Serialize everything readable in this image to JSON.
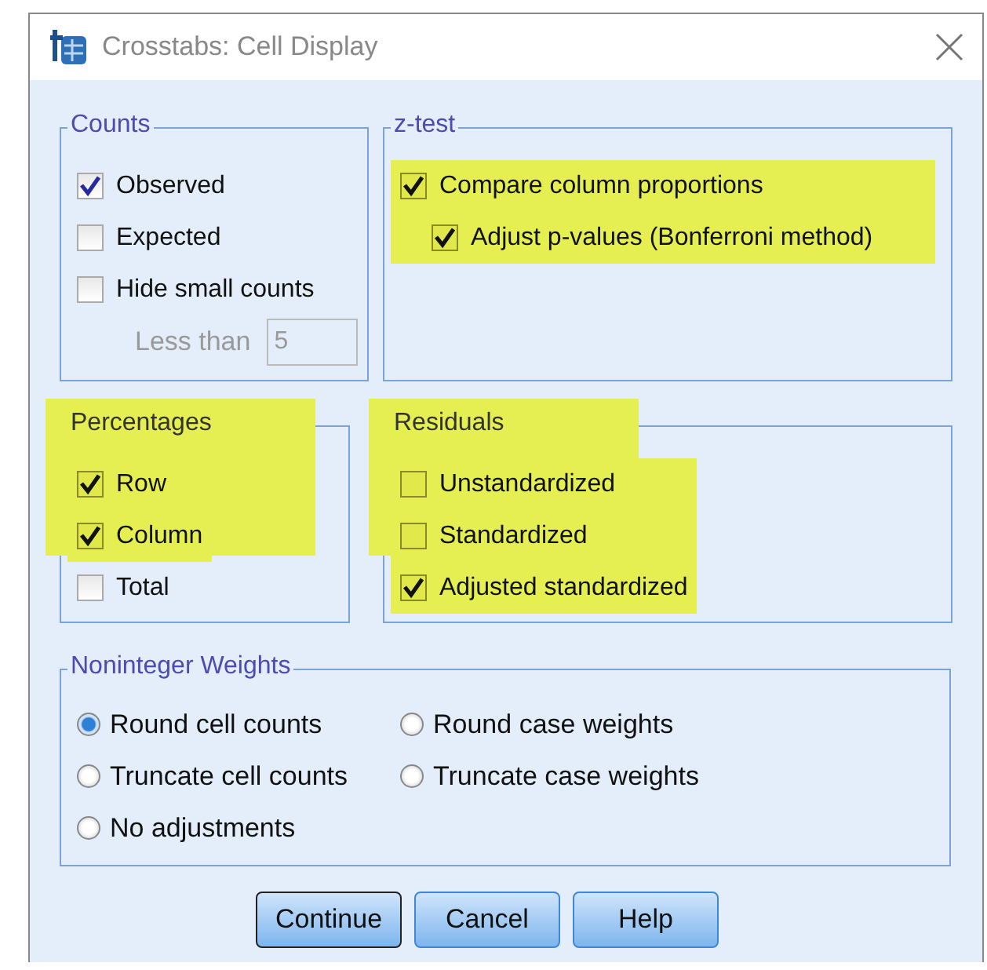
{
  "window": {
    "title": "Crosstabs: Cell Display"
  },
  "groups": [
    {
      "title": "Counts",
      "legend_highlighted": false,
      "items": [
        {
          "label": "Observed",
          "checked": true,
          "highlighted": false
        },
        {
          "label": "Expected",
          "checked": false,
          "highlighted": false
        },
        {
          "label": "Hide small counts",
          "checked": false,
          "highlighted": false
        }
      ],
      "field": {
        "label": "Less than",
        "value": "5",
        "disabled": true
      }
    },
    {
      "title": "z-test",
      "legend_highlighted": false,
      "items": [
        {
          "label": "Compare column proportions",
          "checked": true,
          "highlighted": true
        },
        {
          "label": "Adjust p-values (Bonferroni method)",
          "checked": true,
          "highlighted": true,
          "indented": true
        }
      ]
    },
    {
      "title": "Percentages",
      "legend_highlighted": true,
      "items": [
        {
          "label": "Row",
          "checked": true,
          "highlighted": true
        },
        {
          "label": "Column",
          "checked": true,
          "highlighted": true
        },
        {
          "label": "Total",
          "checked": false,
          "highlighted": false
        }
      ]
    },
    {
      "title": "Residuals",
      "legend_highlighted": true,
      "items": [
        {
          "label": "Unstandardized",
          "checked": false,
          "highlighted": true
        },
        {
          "label": "Standardized",
          "checked": false,
          "highlighted": true
        },
        {
          "label": "Adjusted standardized",
          "checked": true,
          "highlighted": true
        }
      ]
    }
  ],
  "weights": {
    "title": "Noninteger Weights",
    "options": [
      {
        "label": "Round cell counts",
        "selected": true
      },
      {
        "label": "Round case weights",
        "selected": false
      },
      {
        "label": "Truncate cell counts",
        "selected": false
      },
      {
        "label": "Truncate case weights",
        "selected": false
      },
      {
        "label": "No adjustments",
        "selected": false
      }
    ]
  },
  "buttons": [
    {
      "label": "Continue",
      "default": true
    },
    {
      "label": "Cancel",
      "default": false
    },
    {
      "label": "Help",
      "default": false
    }
  ]
}
